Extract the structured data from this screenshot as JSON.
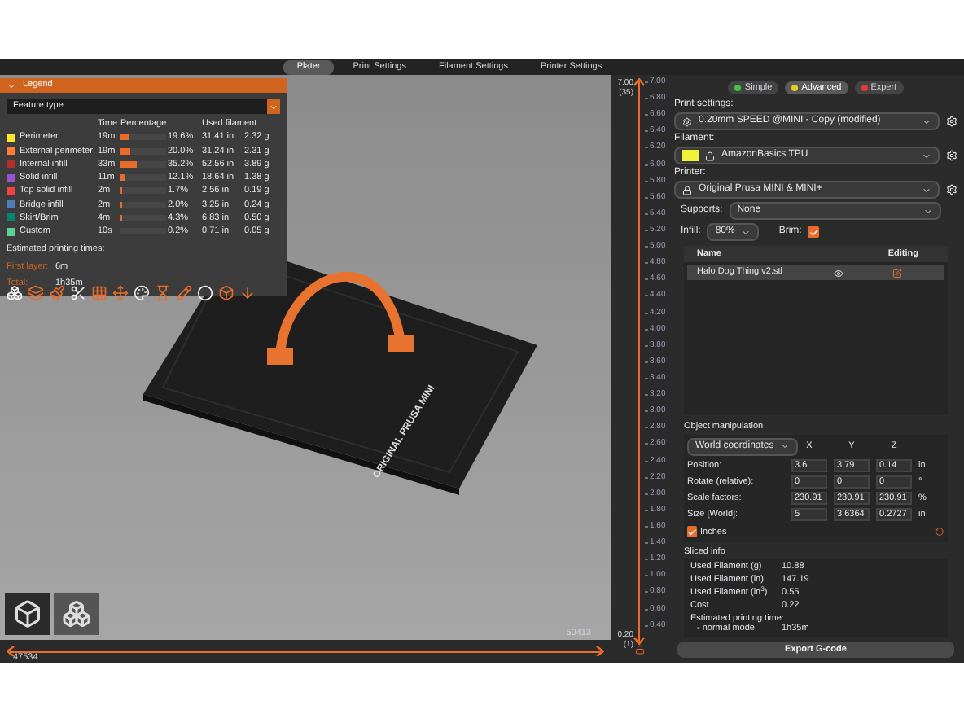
{
  "top_tabs": [
    {
      "label": "Plater",
      "selected": true
    },
    {
      "label": "Print Settings",
      "selected": false
    },
    {
      "label": "Filament Settings",
      "selected": false
    },
    {
      "label": "Printer Settings",
      "selected": false
    }
  ],
  "legend": {
    "title": "Legend",
    "view_type": "Feature type",
    "columns": [
      "Time",
      "Percentage",
      "Used filament"
    ],
    "rows": [
      {
        "name": "Perimeter",
        "color": "#ffe62e",
        "time": "19m",
        "level": 0.196,
        "percentage": "19.6%",
        "length": "31.41 in",
        "weight": "2.32 g"
      },
      {
        "name": "External perimeter",
        "color": "#ff7d38",
        "time": "19m",
        "level": 0.2,
        "percentage": "20.0%",
        "length": "31.24 in",
        "weight": "2.31 g"
      },
      {
        "name": "Internal infill",
        "color": "#b03029",
        "time": "33m",
        "level": 0.352,
        "percentage": "35.2%",
        "length": "52.56 in",
        "weight": "3.89 g"
      },
      {
        "name": "Solid infill",
        "color": "#9654cc",
        "time": "11m",
        "level": 0.121,
        "percentage": "12.1%",
        "length": "18.64 in",
        "weight": "1.38 g"
      },
      {
        "name": "Top solid infill",
        "color": "#f04040",
        "time": "2m",
        "level": 0.017,
        "percentage": "1.7%",
        "length": "2.56 in",
        "weight": "0.19 g"
      },
      {
        "name": "Bridge infill",
        "color": "#4d80ba",
        "time": "2m",
        "level": 0.02,
        "percentage": "2.0%",
        "length": "3.25 in",
        "weight": "0.24 g"
      },
      {
        "name": "Skirt/Brim",
        "color": "#00876e",
        "time": "4m",
        "level": 0.043,
        "percentage": "4.3%",
        "length": "6.83 in",
        "weight": "0.50 g"
      },
      {
        "name": "Custom",
        "color": "#5ed194",
        "time": "10s",
        "level": 0.002,
        "percentage": "0.2%",
        "length": "0.71 in",
        "weight": "0.05 g"
      }
    ],
    "estimated_title": "Estimated printing times:",
    "times": [
      {
        "label": "First layer:",
        "value": "6m"
      },
      {
        "label": "Total:",
        "value": "1h35m"
      }
    ]
  },
  "bed_label": "ORIGINAL PRUSA MINI",
  "vertical_slider": {
    "top_label": "7.00",
    "top_sub": "(35)",
    "bottom_label": "0.20",
    "bottom_sub": "(1)",
    "level": 1,
    "ticks": [
      "7.00",
      "6.80",
      "6.60",
      "6.40",
      "6.20",
      "6.00",
      "5.80",
      "5.60",
      "5.40",
      "5.20",
      "5.00",
      "4.80",
      "4.60",
      "4.40",
      "4.20",
      "4.00",
      "3.80",
      "3.60",
      "3.40",
      "3.20",
      "3.00",
      "2.80",
      "2.60",
      "2.40",
      "2.20",
      "2.00",
      "1.80",
      "1.60",
      "1.40",
      "1.20",
      "1.00",
      "0.80",
      "0.60",
      "0.40"
    ]
  },
  "horizontal_slider": {
    "end_label": "50413",
    "start_label": "47534",
    "level": 1
  },
  "mode_buttons": [
    {
      "label": "Simple",
      "color": "#3ec63e",
      "selected": false
    },
    {
      "label": "Advanced",
      "color": "#e0d020",
      "selected": true
    },
    {
      "label": "Expert",
      "color": "#e03a3a",
      "selected": false
    }
  ],
  "print_settings": {
    "label": "Print settings:",
    "value": "0.20mm SPEED @MINI - Copy (modified)"
  },
  "filament": {
    "label": "Filament:",
    "value": "AmazonBasics TPU",
    "color": "#f2f23a"
  },
  "printer": {
    "label": "Printer:",
    "value": "Original Prusa MINI & MINI+"
  },
  "supports": {
    "label": "Supports:",
    "value": "None"
  },
  "infill": {
    "label": "Infill:",
    "value": "80%"
  },
  "brim": {
    "label": "Brim:",
    "checked": true
  },
  "object_list": {
    "columns": [
      "Name",
      "Editing"
    ],
    "rows": [
      {
        "name": "Halo Dog Thing v2.stl",
        "selected": true
      }
    ]
  },
  "object_manipulation": {
    "title": "Object manipulation",
    "coordinates": "World coordinates",
    "axes": [
      "X",
      "Y",
      "Z"
    ],
    "rows": [
      {
        "label": "Position:",
        "values": [
          "3.6",
          "3.79",
          "0.14"
        ],
        "unit": "in"
      },
      {
        "label": "Rotate (relative):",
        "values": [
          "0",
          "0",
          "0"
        ],
        "unit": "°"
      },
      {
        "label": "Scale factors:",
        "values": [
          "230.91",
          "230.91",
          "230.91"
        ],
        "unit": "%"
      },
      {
        "label": "Size [World]:",
        "values": [
          "5",
          "3.6364",
          "0.2727"
        ],
        "unit": "in"
      }
    ],
    "inches": {
      "label": "Inches",
      "checked": true
    }
  },
  "sliced_info": {
    "title": "Sliced info",
    "rows": [
      {
        "label": "Used Filament (g)",
        "value": "10.88"
      },
      {
        "label": "Used Filament (in)",
        "value": "147.19"
      },
      {
        "label": "Used Filament (in$^{3}$)",
        "value": "0.55"
      },
      {
        "label": "Cost",
        "value": "0.22"
      }
    ],
    "estimated": "Estimated printing time:",
    "mode_label": "- normal mode",
    "mode_value": "1h35m"
  },
  "export_button": "Export G-code"
}
